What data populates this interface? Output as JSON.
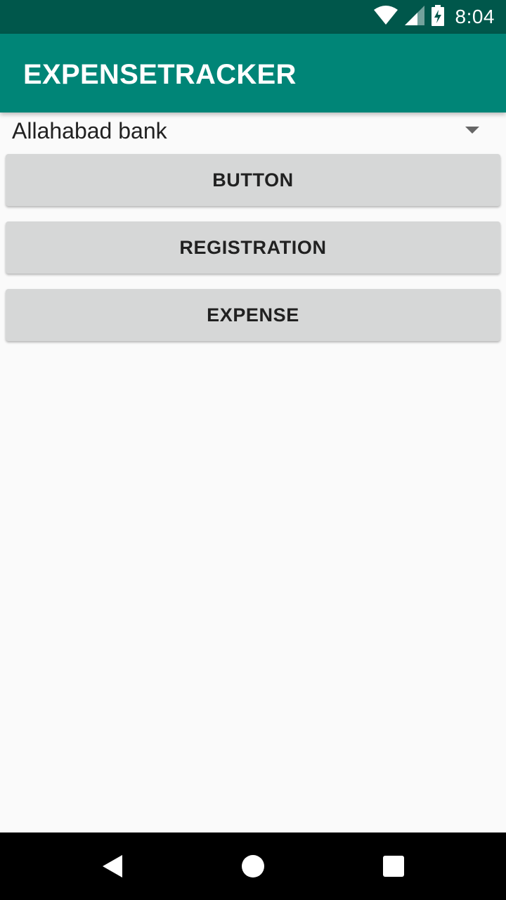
{
  "status_bar": {
    "time": "8:04",
    "icons": [
      "wifi-icon",
      "cell-signal-icon",
      "battery-charging-icon"
    ],
    "background": "#00574b"
  },
  "app_bar": {
    "title": "EXPENSETRACKER",
    "background": "#008577"
  },
  "spinner": {
    "selected_value": "Allahabad bank",
    "icon": "dropdown-arrow-icon"
  },
  "buttons": [
    {
      "label": "BUTTON"
    },
    {
      "label": "REGISTRATION"
    },
    {
      "label": "EXPENSE"
    }
  ],
  "nav_bar": {
    "icons": [
      "back-icon",
      "home-icon",
      "recents-icon"
    ]
  }
}
